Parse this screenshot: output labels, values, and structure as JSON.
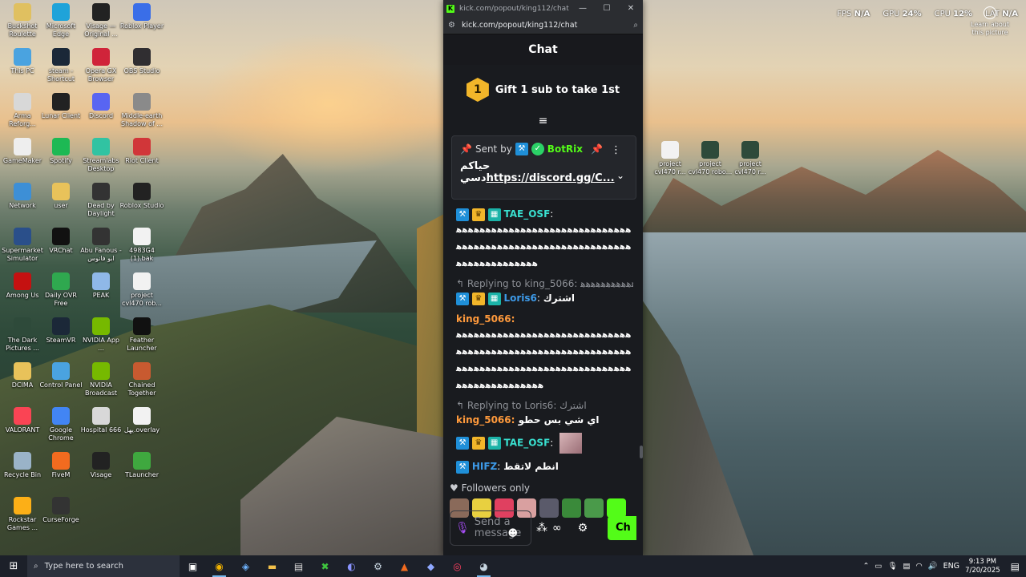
{
  "desktop": {
    "icons": [
      {
        "label": "Buckshot Roulette",
        "icon": "buckshot-icon",
        "color": "#e0c060"
      },
      {
        "label": "Microsoft Edge",
        "icon": "edge-icon",
        "color": "#1fa3d9"
      },
      {
        "label": "Visage — Original ...",
        "icon": "visage-icon",
        "color": "#222222"
      },
      {
        "label": "Roblox Player",
        "icon": "roblox-icon",
        "color": "#3a6ee8"
      },
      {
        "label": "This PC",
        "icon": "pc-icon",
        "color": "#4aa3e0"
      },
      {
        "label": "steam - Shortcut",
        "icon": "steam-icon",
        "color": "#1b2838"
      },
      {
        "label": "Opera GX Browser",
        "icon": "opera-icon",
        "color": "#d0243a"
      },
      {
        "label": "OBS Studio",
        "icon": "obs-icon",
        "color": "#302e31"
      },
      {
        "label": "Arma Reforg...",
        "icon": "arma-icon",
        "color": "#d8d8d8"
      },
      {
        "label": "Lunar Client",
        "icon": "lunar-icon",
        "color": "#222222"
      },
      {
        "label": "Discord",
        "icon": "discord-icon",
        "color": "#5865f2"
      },
      {
        "label": "Middle-earth Shadow of ...",
        "icon": "middle-earth-icon",
        "color": "#8a8a8a"
      },
      {
        "label": "GameMaker",
        "icon": "gamemaker-icon",
        "color": "#eeeeee"
      },
      {
        "label": "Spotify",
        "icon": "spotify-icon",
        "color": "#1db954"
      },
      {
        "label": "Streamlabs Desktop",
        "icon": "streamlabs-icon",
        "color": "#31c3a2"
      },
      {
        "label": "Riot Client",
        "icon": "riot-icon",
        "color": "#d13639"
      },
      {
        "label": "Network",
        "icon": "network-icon",
        "color": "#3d8fd6"
      },
      {
        "label": "user",
        "icon": "folder-icon",
        "color": "#e8c25a"
      },
      {
        "label": "Dead by Daylight",
        "icon": "dbd-icon",
        "color": "#333333"
      },
      {
        "label": "Roblox Studio",
        "icon": "roblox-studio-icon",
        "color": "#222222"
      },
      {
        "label": "Supermarket Simulator",
        "icon": "supermarket-icon",
        "color": "#2a4f8a"
      },
      {
        "label": "VRChat",
        "icon": "vrchat-icon",
        "color": "#111111"
      },
      {
        "label": "Abu Fanous - ابو فانوس",
        "icon": "abu-fanous-icon",
        "color": "#333333"
      },
      {
        "label": "4983G4 (1).bak",
        "icon": "file-icon",
        "color": "#f2f2f2"
      },
      {
        "label": "Among Us",
        "icon": "among-us-icon",
        "color": "#c51111"
      },
      {
        "label": "Daily OVR Free",
        "icon": "ovr-icon",
        "color": "#2fa84f"
      },
      {
        "label": "PEAK",
        "icon": "peak-icon",
        "color": "#8fb8e8"
      },
      {
        "label": "project cvl470 rob...",
        "icon": "file-icon",
        "color": "#f2f2f2"
      },
      {
        "label": "The Dark Pictures ...",
        "icon": "dark-pictures-icon",
        "color": "#2e4a3a"
      },
      {
        "label": "SteamVR",
        "icon": "steamvr-icon",
        "color": "#1b2838"
      },
      {
        "label": "NVIDIA App ...",
        "icon": "nvidia-icon",
        "color": "#76b900"
      },
      {
        "label": "Feather Launcher",
        "icon": "feather-icon",
        "color": "#111111"
      },
      {
        "label": "DCIMA",
        "icon": "folder-icon",
        "color": "#e8c25a"
      },
      {
        "label": "Control Panel",
        "icon": "control-panel-icon",
        "color": "#4aa3e0"
      },
      {
        "label": "NVIDIA Broadcast",
        "icon": "nvidia-broadcast-icon",
        "color": "#76b900"
      },
      {
        "label": "Chained Together",
        "icon": "chained-icon",
        "color": "#c85a30"
      },
      {
        "label": "VALORANT",
        "icon": "valorant-icon",
        "color": "#fa4454"
      },
      {
        "label": "Google Chrome",
        "icon": "chrome-icon",
        "color": "#4285f4"
      },
      {
        "label": "Hospital 666",
        "icon": "hospital-icon",
        "color": "#d8d8d8"
      },
      {
        "label": "يهل.overlay",
        "icon": "file-icon",
        "color": "#f2f2f2"
      },
      {
        "label": "Recycle Bin",
        "icon": "recycle-bin-icon",
        "color": "#9ab3c8"
      },
      {
        "label": "FiveM",
        "icon": "fivem-icon",
        "color": "#f26b1f"
      },
      {
        "label": "Visage",
        "icon": "visage-icon",
        "color": "#222222"
      },
      {
        "label": "TLauncher",
        "icon": "tlauncher-icon",
        "color": "#3fa83f"
      },
      {
        "label": "Rockstar Games ...",
        "icon": "rockstar-icon",
        "color": "#fcaf17"
      },
      {
        "label": "CurseForge",
        "icon": "curseforge-icon",
        "color": "#333333"
      }
    ],
    "right_icons": [
      {
        "label": "project cvl470 r...",
        "icon": "file-icon",
        "color": "#f2f2f2"
      },
      {
        "label": "project cvl470 robo...",
        "icon": "blender-file-icon",
        "color": "#2e4a3a"
      },
      {
        "label": "project cvl470 r...",
        "icon": "blender-file-icon",
        "color": "#2e4a3a"
      }
    ]
  },
  "perf": {
    "fps_label": "FPS",
    "fps_value": "N/A",
    "gpu_label": "GPU",
    "gpu_value": "24%",
    "cpu_label": "CPU",
    "cpu_value": "12%",
    "lat_label": "LAT",
    "lat_value": "N/A"
  },
  "learn": {
    "label": "Learn about this picture"
  },
  "browser": {
    "title": "kick.com/popout/king112/chat - Goo...",
    "url": "kick.com/popout/king112/chat",
    "minimize": "—",
    "maximize": "☐",
    "close": "✕"
  },
  "chat": {
    "header": "Chat",
    "gift_number": "1",
    "gift_text": "Gift 1 sub to take 1st",
    "pinned": {
      "sent_by": "Sent by",
      "sender": "BotRix",
      "line1": "حياكم",
      "line2_prefix": "دسي",
      "line2_link": "https://discord.gg/C..."
    },
    "messages": [
      {
        "user": "TAE_OSF",
        "body": "ﻫﻫﻫﻫﻫﻫﻫﻫﻫﻫﻫﻫﻫﻫﻫﻫﻫﻫﻫﻫﻫﻫﻫﻫﻫﻫﻫﻫﻫﻫﻫﻫﻫﻫﻫﻫﻫﻫﻫﻫﻫﻫﻫﻫﻫﻫﻫﻫﻫﻫﻫﻫﻫﻫﻫﻫﻫﻫﻫﻫﻫﻫﻫﻫﻫﻫﻫﻫﻫﻫﻫﻫﻫﻫ"
      },
      {
        "reply": "Replying to king_5066: ﻫﻫﻫﻫﻫﻫﻫﻫﻫﻫﻫ...",
        "user": "Loris6",
        "body": "اشترك"
      },
      {
        "user": "king_5066",
        "body": "ﻫﻫﻫﻫﻫﻫﻫﻫﻫﻫﻫﻫﻫﻫﻫﻫﻫﻫﻫﻫﻫﻫﻫﻫﻫﻫﻫﻫﻫﻫﻫﻫﻫﻫﻫﻫﻫﻫﻫﻫﻫﻫﻫﻫﻫﻫﻫﻫﻫﻫﻫﻫﻫﻫﻫﻫﻫﻫﻫﻫﻫﻫﻫﻫﻫﻫﻫﻫﻫﻫﻫﻫﻫﻫﻫﻫﻫﻫﻫﻫﻫﻫﻫﻫﻫﻫﻫﻫﻫﻫﻫﻫﻫﻫﻫﻫﻫﻫﻫﻫﻫﻫﻫﻫﻫ"
      },
      {
        "reply": "Replying to Loris6: اشترك",
        "user": "king_5066",
        "body": "اي شي بس حطو"
      },
      {
        "user": "TAE_OSF",
        "body": ""
      },
      {
        "user": "HIFZ",
        "body": "انطم لاتقط"
      }
    ],
    "followers_only": "Followers only",
    "input_placeholder": "Send a message",
    "chat_button": "Ch"
  },
  "taskbar": {
    "search_placeholder": "Type here to search",
    "lang": "ENG",
    "time": "9:13 PM",
    "date": "7/20/2025"
  }
}
